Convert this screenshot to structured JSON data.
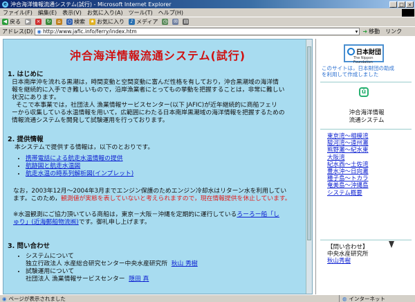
{
  "window": {
    "title": "沖合海洋情報流通システム(試行) - Microsoft Internet Explorer"
  },
  "menu": [
    "ファイル(F)",
    "編集(E)",
    "表示(V)",
    "お気に入り(A)",
    "ツール(T)",
    "ヘルプ(H)"
  ],
  "toolbar": {
    "back": "戻る",
    "search": "検索",
    "favorites": "お気に入り",
    "media": "メディア"
  },
  "address": {
    "label": "アドレス(D)",
    "url": "http://www.jafic.info/ferry/index.htm",
    "go": "移動",
    "links": "リンク"
  },
  "page": {
    "title": "沖合海洋情報流通システム(試行)",
    "s1_heading": "1. はじめに",
    "s1_p1_l1": "日本南岸沖を流れる黒潮は，時間変動と空間変動に富んだ性格を有しており，沖合黒潮域の海洋情",
    "s1_p1_l2": "報を継続的に入手でき難しいもので，沿岸漁業者にとってもの挙動を把握することは，非常に難しい",
    "s1_p1_l3": "状況にあります。",
    "s1_p2_l1": "そこで本事業では，社団法人 漁業情報サービスセンター(以下 JAFIC)が近年継続的に商船フェリ",
    "s1_p2_l2": "ーから収集している水温情報を用いて，広範囲にわたる日本南岸黒潮域の海洋情報を把握するための",
    "s1_p2_l3": "情報流通システムを開発して試験運用を行っております。",
    "s2_heading": "2. 提供情報",
    "s2_intro": "本システムで提供する情報は，以下のとおりです。",
    "s2_links": [
      "携帯電話による航走水温情報の提供",
      "航跡図と航走水温図",
      "航走水温の時系列解析図(インプレット)"
    ],
    "notice_l1": "なお，2003年12月〜2004年3月までエンジン保護のためエンジン冷却水はリターン水を利用してい",
    "notice_l2_a": "ます。このため，",
    "notice_l2_red": "観測値が実態を表していないと考えられますので，現在情報提供を休止しています。",
    "obs_l1_a": "※水温観測にご協力頂いている商船は，東京－大阪－沖縄を定期的に運行している",
    "obs_l1_link": "ろーろー船「し",
    "obs_l2_link": "ゅり」(近海郵船物流㈱)",
    "obs_l2_b": "です。御礼申し上げます。",
    "s3_heading": "3. 問い合わせ",
    "s3_item1": "システムについて",
    "s3_item1_org": "独立行政法人 水産総合研究センター中央水産研究所",
    "s3_item1_person": "秋山 秀樹",
    "s3_item2": "試験運用について",
    "s3_item2_org": "社団法人 漁業情報サービスセンター",
    "s3_item2_person": "隠田 真"
  },
  "sidebar": {
    "sponsor_jp": "日本財団",
    "sponsor_en": "The Nippon Foundation",
    "note_l1": "このサイトは，日本財団の助成",
    "note_l2": "を利用して作成しました",
    "system_l1": "沖合海洋情報",
    "system_l2": "流通システム",
    "links": [
      "東京湾～相模湾",
      "駿河湾～遠州灘",
      "熊野灘～紀水東",
      "大阪湾",
      "紀水西～土佐湾",
      "豊水沖～日向灘",
      "種子島～トカラ",
      "奄美島～沖縄島",
      "システム概要"
    ],
    "contact_title": "【問い合わせ】",
    "contact_org": "中央水産研究所",
    "contact_person": "秋山秀樹"
  },
  "status": {
    "text": "ページが表示されました",
    "zone": "インターネット"
  },
  "colors": {
    "content_bg": "#a8dcf0",
    "title_red": "#d01010",
    "link": "#0b1fd1"
  }
}
